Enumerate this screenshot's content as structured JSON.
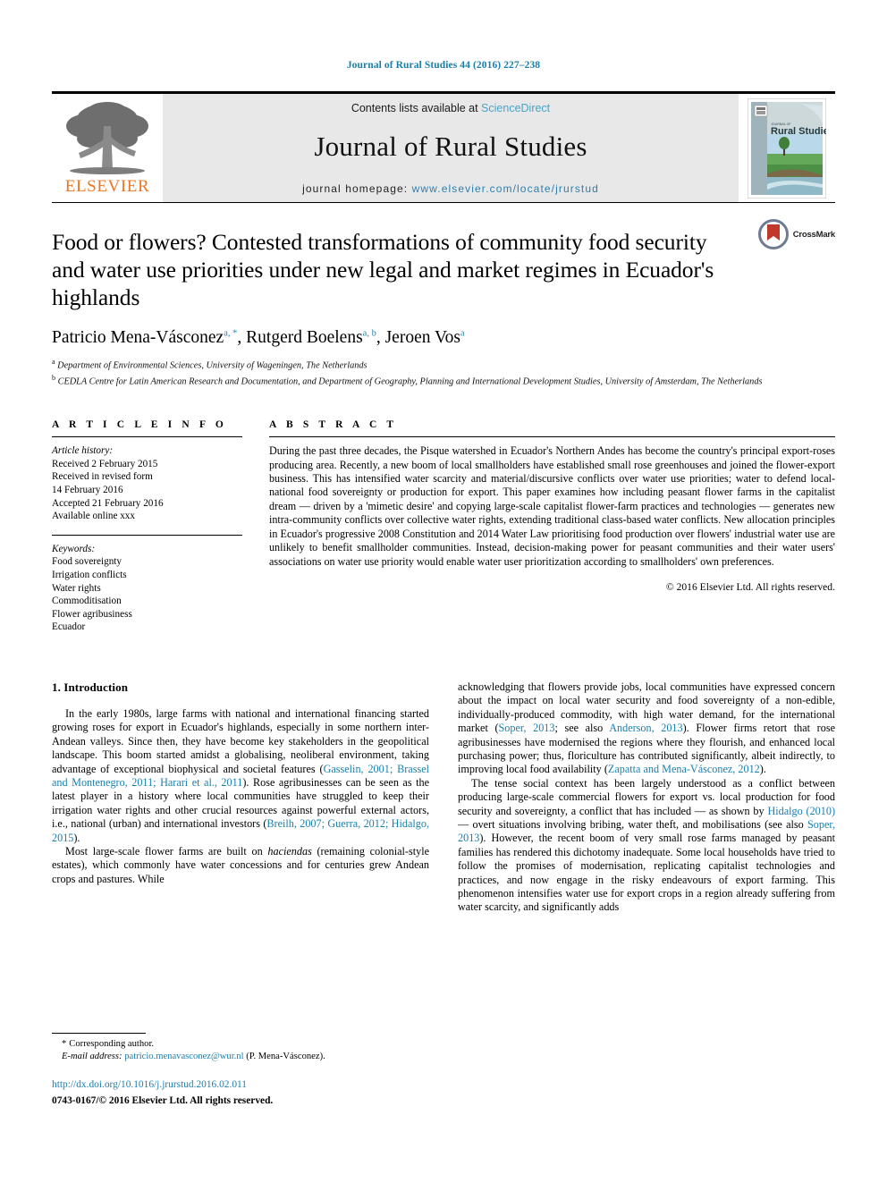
{
  "running_head": "Journal of Rural Studies 44 (2016) 227–238",
  "masthead": {
    "publisher_logo_text": "ELSEVIER",
    "contents_prefix": "Contents lists available at ",
    "contents_link": "ScienceDirect",
    "journal_name": "Journal of Rural Studies",
    "homepage_prefix": "journal homepage: ",
    "homepage_url": "www.elsevier.com/locate/jrurstud",
    "cover_title_small": "JOURNAL OF",
    "cover_title": "Rural Studies"
  },
  "article": {
    "title": "Food or flowers? Contested transformations of community food security and water use priorities under new legal and market regimes in Ecuador's highlands",
    "crossmark_label": "CrossMark",
    "authors": [
      {
        "name": "Patricio Mena-Vásconez",
        "marks": "a, *"
      },
      {
        "name": "Rutgerd Boelens",
        "marks": "a, b"
      },
      {
        "name": "Jeroen Vos",
        "marks": "a"
      }
    ],
    "affiliations": [
      {
        "mark": "a",
        "text": "Department of Environmental Sciences, University of Wageningen, The Netherlands"
      },
      {
        "mark": "b",
        "text": "CEDLA Centre for Latin American Research and Documentation, and Department of Geography, Planning and International Development Studies, University of Amsterdam, The Netherlands"
      }
    ]
  },
  "article_info": {
    "heading": "A R T I C L E   I N F O",
    "history_label": "Article history:",
    "history": [
      "Received 2 February 2015",
      "Received in revised form",
      "14 February 2016",
      "Accepted 21 February 2016",
      "Available online xxx"
    ],
    "keywords_label": "Keywords:",
    "keywords": [
      "Food sovereignty",
      "Irrigation conflicts",
      "Water rights",
      "Commoditisation",
      "Flower agribusiness",
      "Ecuador"
    ]
  },
  "abstract": {
    "heading": "A B S T R A C T",
    "text": "During the past three decades, the Pisque watershed in Ecuador's Northern Andes has become the country's principal export-roses producing area. Recently, a new boom of local smallholders have established small rose greenhouses and joined the flower-export business. This has intensified water scarcity and material/discursive conflicts over water use priorities; water to defend local-national food sovereignty or production for export. This paper examines how including peasant flower farms in the capitalist dream — driven by a 'mimetic desire' and copying large-scale capitalist flower-farm practices and technologies — generates new intra-community conflicts over collective water rights, extending traditional class-based water conflicts. New allocation principles in Ecuador's progressive 2008 Constitution and 2014 Water Law prioritising food production over flowers' industrial water use are unlikely to benefit smallholder communities. Instead, decision-making power for peasant communities and their water users' associations on water use priority would enable water user prioritization according to smallholders' own preferences.",
    "copyright": "© 2016 Elsevier Ltd. All rights reserved."
  },
  "introduction": {
    "section_number_title": "1. Introduction",
    "left_paragraphs": [
      {
        "parts": [
          {
            "t": "In the early 1980s, large farms with national and international financing started growing roses for export in Ecuador's highlands, especially in some northern inter-Andean valleys. Since then, they have become key stakeholders in the geopolitical landscape. This boom started amidst a globalising, neoliberal environment, taking advantage of exceptional biophysical and societal features (",
            "s": "plain"
          },
          {
            "t": "Gasselin, 2001; Brassel and Montenegro, 2011; Harari et al., 2011",
            "s": "ref"
          },
          {
            "t": "). Rose agribusinesses can be seen as the latest player in a history where local communities have struggled to keep their irrigation water rights and other crucial resources against powerful external actors, i.e., national (urban) and international investors (",
            "s": "plain"
          },
          {
            "t": "Breilh, 2007; Guerra, 2012; Hidalgo, 2015",
            "s": "ref"
          },
          {
            "t": ").",
            "s": "plain"
          }
        ]
      },
      {
        "parts": [
          {
            "t": "Most large-scale flower farms are built on ",
            "s": "plain"
          },
          {
            "t": "haciendas",
            "s": "ital"
          },
          {
            "t": " (remaining colonial-style estates), which commonly have water concessions and for centuries grew Andean crops and pastures. While",
            "s": "plain"
          }
        ]
      }
    ],
    "right_paragraphs": [
      {
        "parts": [
          {
            "t": "acknowledging that flowers provide jobs, local communities have expressed concern about the impact on local water security and food sovereignty of a non-edible, individually-produced commodity, with high water demand, for the international market (",
            "s": "plain"
          },
          {
            "t": "Soper, 2013",
            "s": "ref"
          },
          {
            "t": "; see also ",
            "s": "plain"
          },
          {
            "t": "Anderson, 2013",
            "s": "ref"
          },
          {
            "t": "). Flower firms retort that rose agribusinesses have modernised the regions where they flourish, and enhanced local purchasing power; thus, floriculture has contributed significantly, albeit indirectly, to improving local food availability (",
            "s": "plain"
          },
          {
            "t": "Zapatta and Mena-Vásconez, 2012",
            "s": "ref"
          },
          {
            "t": ").",
            "s": "plain"
          }
        ]
      },
      {
        "parts": [
          {
            "t": "The tense social context has been largely understood as a conflict between producing large-scale commercial flowers for export vs. local production for food security and sovereignty, a conflict that has included — as shown by ",
            "s": "plain"
          },
          {
            "t": "Hidalgo (2010)",
            "s": "ref"
          },
          {
            "t": " — overt situations involving bribing, water theft, and mobilisations (see also ",
            "s": "plain"
          },
          {
            "t": "Soper, 2013",
            "s": "ref"
          },
          {
            "t": "). However, the recent boom of very small rose farms managed by peasant families has rendered this dichotomy inadequate. Some local households have tried to follow the promises of modernisation, replicating capitalist technologies and practices, and now engage in the risky endeavours of export farming. This phenomenon intensifies water use for export crops in a region already suffering from water scarcity, and significantly adds",
            "s": "plain"
          }
        ]
      }
    ]
  },
  "footnotes": {
    "corresponding_star": "*",
    "corresponding_text": "Corresponding author.",
    "email_label": "E-mail address:",
    "email_link": "patricio.menavasconez@wur.nl",
    "email_suffix": "(P. Mena-Vásconez).",
    "doi": "http://dx.doi.org/10.1016/j.jrurstud.2016.02.011",
    "issn_line": "0743-0167/© 2016 Elsevier Ltd. All rights reserved."
  },
  "colors": {
    "link_blue": "#1b7fad",
    "elsevier_orange": "#ec7623",
    "banner_gray": "#e8e8e8"
  }
}
